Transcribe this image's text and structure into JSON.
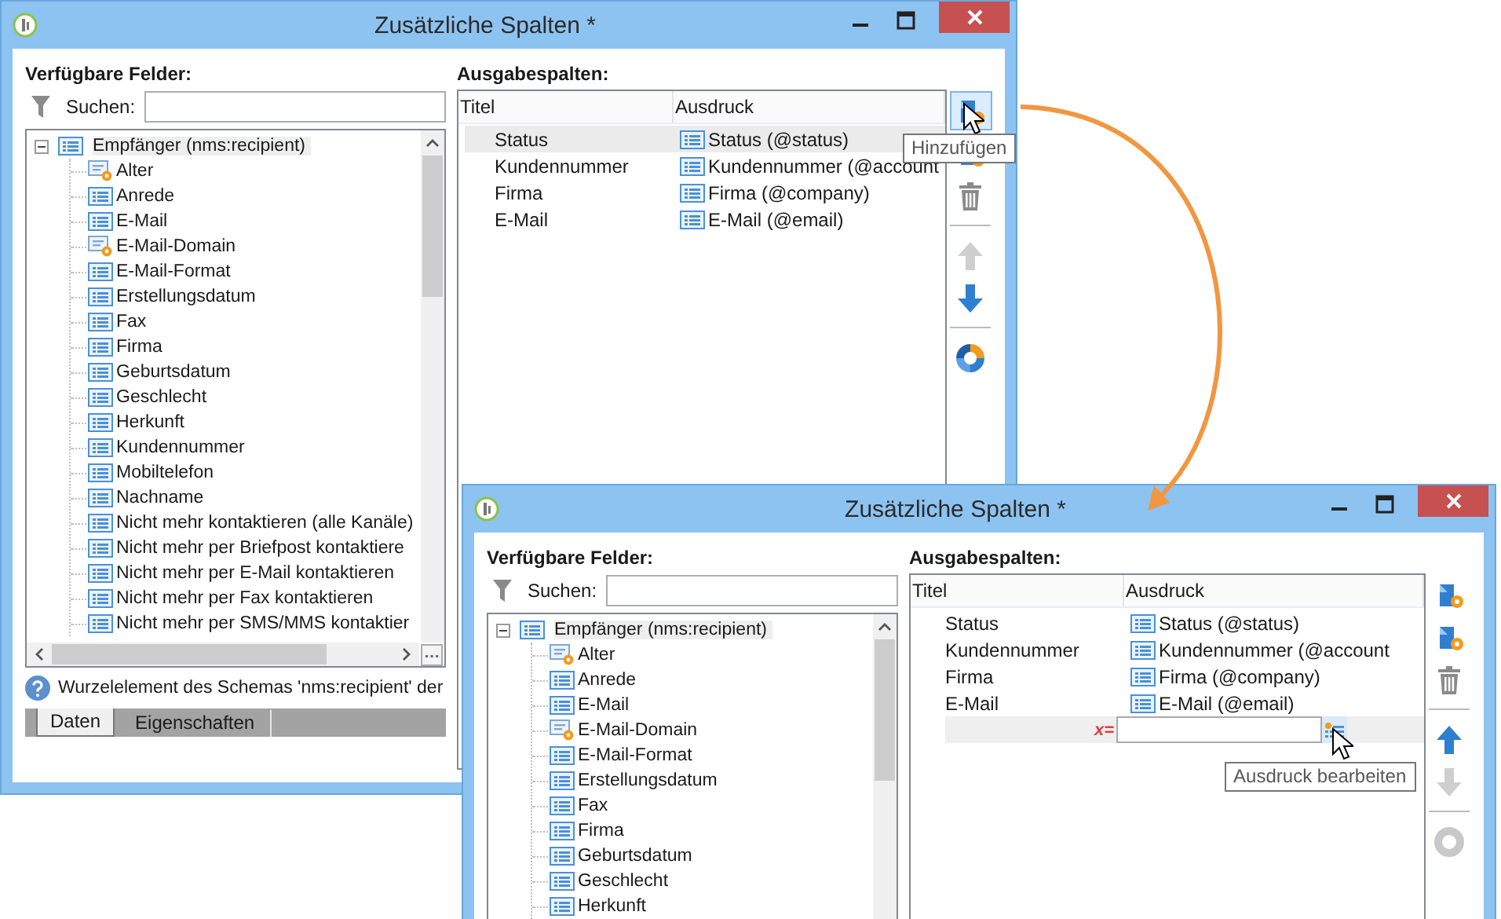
{
  "windows": [
    {
      "title": "Zusätzliche Spalten *",
      "available": {
        "heading": "Verfügbare Felder:",
        "search_label": "Suchen:",
        "tree": {
          "label": "Empfänger (nms:recipient)",
          "expanded": true,
          "children": [
            {
              "label": "Alter",
              "kind": "calculated"
            },
            {
              "label": "Anrede",
              "kind": "field"
            },
            {
              "label": "E-Mail",
              "kind": "field"
            },
            {
              "label": "E-Mail-Domain",
              "kind": "calculated"
            },
            {
              "label": "E-Mail-Format",
              "kind": "field"
            },
            {
              "label": "Erstellungsdatum",
              "kind": "field"
            },
            {
              "label": "Fax",
              "kind": "field"
            },
            {
              "label": "Firma",
              "kind": "field"
            },
            {
              "label": "Geburtsdatum",
              "kind": "field"
            },
            {
              "label": "Geschlecht",
              "kind": "field"
            },
            {
              "label": "Herkunft",
              "kind": "field"
            },
            {
              "label": "Kundennummer",
              "kind": "field"
            },
            {
              "label": "Mobiltelefon",
              "kind": "field"
            },
            {
              "label": "Nachname",
              "kind": "field"
            },
            {
              "label": "Nicht mehr kontaktieren (alle Kanäle)",
              "kind": "field"
            },
            {
              "label": "Nicht mehr per Briefpost kontaktiere",
              "kind": "field"
            },
            {
              "label": "Nicht mehr per E-Mail kontaktieren",
              "kind": "field"
            },
            {
              "label": "Nicht mehr per Fax kontaktieren",
              "kind": "field"
            },
            {
              "label": "Nicht mehr per SMS/MMS kontaktier",
              "kind": "field"
            }
          ]
        }
      },
      "status_text": "Wurzelelement des Schemas 'nms:recipient' der",
      "tabs": [
        {
          "label": "Daten",
          "selected": true
        },
        {
          "label": "Eigenschaften",
          "selected": false
        }
      ],
      "output": {
        "heading": "Ausgabespalten:",
        "columns": [
          "Titel",
          "Ausdruck"
        ],
        "rows": [
          {
            "title": "Status",
            "expression": "Status (@status)",
            "selected": true
          },
          {
            "title": "Kundennummer",
            "expression": "Kundennummer (@account",
            "selected": false
          },
          {
            "title": "Firma",
            "expression": "Firma (@company)",
            "selected": false
          },
          {
            "title": "E-Mail",
            "expression": "E-Mail (@email)",
            "selected": false
          }
        ],
        "toolbar": [
          {
            "kind": "add",
            "hovered": true,
            "disabled": false
          },
          {
            "kind": "add",
            "hovered": false,
            "disabled": false
          },
          {
            "kind": "delete",
            "hovered": false,
            "disabled": false
          },
          {
            "kind": "separator"
          },
          {
            "kind": "up",
            "hovered": false,
            "disabled": true
          },
          {
            "kind": "down",
            "hovered": false,
            "disabled": false
          },
          {
            "kind": "separator"
          },
          {
            "kind": "chart",
            "hovered": false,
            "disabled": false
          }
        ]
      },
      "tooltip": {
        "text": "Hinzufügen"
      }
    },
    {
      "title": "Zusätzliche Spalten *",
      "available": {
        "heading": "Verfügbare Felder:",
        "search_label": "Suchen:",
        "tree": {
          "label": "Empfänger (nms:recipient)",
          "expanded": true,
          "children": [
            {
              "label": "Alter",
              "kind": "calculated"
            },
            {
              "label": "Anrede",
              "kind": "field"
            },
            {
              "label": "E-Mail",
              "kind": "field"
            },
            {
              "label": "E-Mail-Domain",
              "kind": "calculated"
            },
            {
              "label": "E-Mail-Format",
              "kind": "field"
            },
            {
              "label": "Erstellungsdatum",
              "kind": "field"
            },
            {
              "label": "Fax",
              "kind": "field"
            },
            {
              "label": "Firma",
              "kind": "field"
            },
            {
              "label": "Geburtsdatum",
              "kind": "field"
            },
            {
              "label": "Geschlecht",
              "kind": "field"
            },
            {
              "label": "Herkunft",
              "kind": "field"
            }
          ]
        }
      },
      "output": {
        "heading": "Ausgabespalten:",
        "columns": [
          "Titel",
          "Ausdruck"
        ],
        "rows": [
          {
            "title": "Status",
            "expression": "Status (@status)",
            "selected": false
          },
          {
            "title": "Kundennummer",
            "expression": "Kundennummer (@account",
            "selected": false
          },
          {
            "title": "Firma",
            "expression": "Firma (@company)",
            "selected": false
          },
          {
            "title": "E-Mail",
            "expression": "E-Mail (@email)",
            "selected": false
          }
        ],
        "edit_row": {
          "formula_mark": "x="
        },
        "toolbar": [
          {
            "kind": "add",
            "hovered": false,
            "disabled": false
          },
          {
            "kind": "add",
            "hovered": false,
            "disabled": false
          },
          {
            "kind": "delete",
            "hovered": false,
            "disabled": false
          },
          {
            "kind": "separator"
          },
          {
            "kind": "up",
            "hovered": false,
            "disabled": false
          },
          {
            "kind": "down",
            "hovered": false,
            "disabled": true
          },
          {
            "kind": "separator"
          },
          {
            "kind": "chart",
            "hovered": false,
            "disabled": true
          }
        ]
      },
      "tooltip": {
        "text": "Ausdruck bearbeiten"
      }
    }
  ]
}
